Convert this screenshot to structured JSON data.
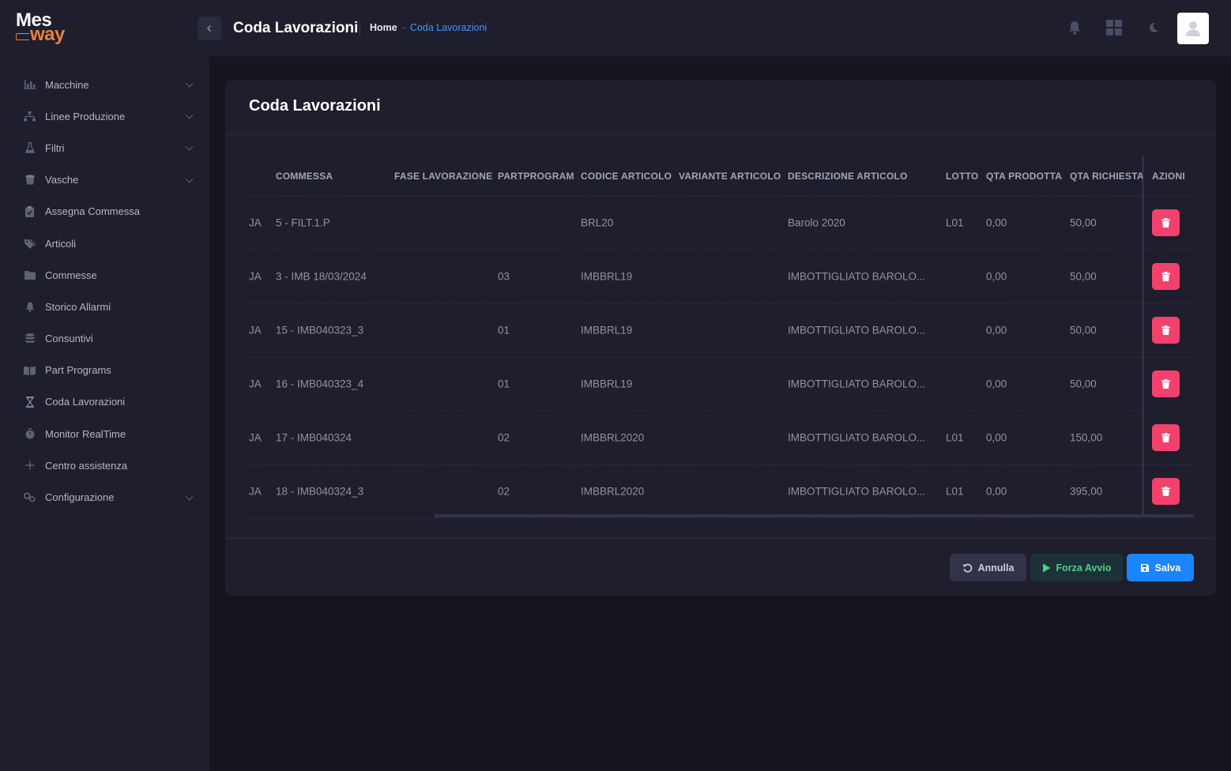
{
  "app": {
    "logo_top": "Mes",
    "logo_bottom": "way"
  },
  "header": {
    "title": "Coda Lavorazioni",
    "breadcrumb_home": "Home",
    "breadcrumb_sep": "-",
    "breadcrumb_current": "Coda Lavorazioni"
  },
  "sidebar": {
    "items": [
      {
        "label": "Macchine",
        "icon": "chart-bar-icon",
        "has_submenu": true
      },
      {
        "label": "Linee Produzione",
        "icon": "sitemap-icon",
        "has_submenu": true
      },
      {
        "label": "Filtri",
        "icon": "flask-icon",
        "has_submenu": true
      },
      {
        "label": "Vasche",
        "icon": "bucket-icon",
        "has_submenu": true
      },
      {
        "label": "Assegna Commessa",
        "icon": "clipboard-check-icon",
        "has_submenu": false
      },
      {
        "label": "Articoli",
        "icon": "tags-icon",
        "has_submenu": false
      },
      {
        "label": "Commesse",
        "icon": "folder-icon",
        "has_submenu": false
      },
      {
        "label": "Storico Allarmi",
        "icon": "bell-icon",
        "has_submenu": false
      },
      {
        "label": "Consuntivi",
        "icon": "database-icon",
        "has_submenu": false
      },
      {
        "label": "Part Programs",
        "icon": "book-icon",
        "has_submenu": false
      },
      {
        "label": "Coda Lavorazioni",
        "icon": "hourglass-icon",
        "has_submenu": false
      },
      {
        "label": "Monitor RealTime",
        "icon": "stopwatch-icon",
        "has_submenu": false
      },
      {
        "label": "Centro assistenza",
        "icon": "plus-icon",
        "has_submenu": false
      },
      {
        "label": "Configurazione",
        "icon": "gears-icon",
        "has_submenu": true
      }
    ]
  },
  "card": {
    "title": "Coda Lavorazioni"
  },
  "table": {
    "columns": [
      "",
      "COMMESSA",
      "FASE LAVORAZIONE",
      "PARTPROGRAM",
      "CODICE ARTICOLO",
      "VARIANTE ARTICOLO",
      "DESCRIZIONE ARTICOLO",
      "LOTTO",
      "QTA PRODOTTA",
      "QTA RICHIESTA",
      "AZIONI"
    ],
    "rows": [
      {
        "prefix": "JA",
        "commessa": "5 - FILT.1.P",
        "fase": "",
        "partprogram": "",
        "codice": "BRL20",
        "variante": "",
        "descrizione": "Barolo 2020",
        "lotto": "L01",
        "qta_prodotta": "0,00",
        "qta_richiesta": "50,00"
      },
      {
        "prefix": "JA",
        "commessa": "3 - IMB 18/03/2024",
        "fase": "",
        "partprogram": "03",
        "codice": "IMBBRL19",
        "variante": "",
        "descrizione": "IMBOTTIGLIATO BAROLO...",
        "lotto": "",
        "qta_prodotta": "0,00",
        "qta_richiesta": "50,00"
      },
      {
        "prefix": "JA",
        "commessa": "15 - IMB040323_3",
        "fase": "",
        "partprogram": "01",
        "codice": "IMBBRL19",
        "variante": "",
        "descrizione": "IMBOTTIGLIATO BAROLO...",
        "lotto": "",
        "qta_prodotta": "0,00",
        "qta_richiesta": "50,00"
      },
      {
        "prefix": "JA",
        "commessa": "16 - IMB040323_4",
        "fase": "",
        "partprogram": "01",
        "codice": "IMBBRL19",
        "variante": "",
        "descrizione": "IMBOTTIGLIATO BAROLO...",
        "lotto": "",
        "qta_prodotta": "0,00",
        "qta_richiesta": "50,00"
      },
      {
        "prefix": "JA",
        "commessa": "17 - IMB040324",
        "fase": "",
        "partprogram": "02",
        "codice": "IMBBRL2020",
        "variante": "",
        "descrizione": "IMBOTTIGLIATO BAROLO...",
        "lotto": "L01",
        "qta_prodotta": "0,00",
        "qta_richiesta": "150,00"
      },
      {
        "prefix": "JA",
        "commessa": "18 - IMB040324_3",
        "fase": "",
        "partprogram": "02",
        "codice": "IMBBRL2020",
        "variante": "",
        "descrizione": "IMBOTTIGLIATO BAROLO...",
        "lotto": "L01",
        "qta_prodotta": "0,00",
        "qta_richiesta": "395,00"
      }
    ]
  },
  "actions": {
    "annulla": "Annulla",
    "forza_avvio": "Forza Avvio",
    "salva": "Salva"
  },
  "colors": {
    "accent": "#1b84ff",
    "danger": "#f1416c",
    "success": "#50cd89",
    "logo_orange": "#e8803a"
  }
}
